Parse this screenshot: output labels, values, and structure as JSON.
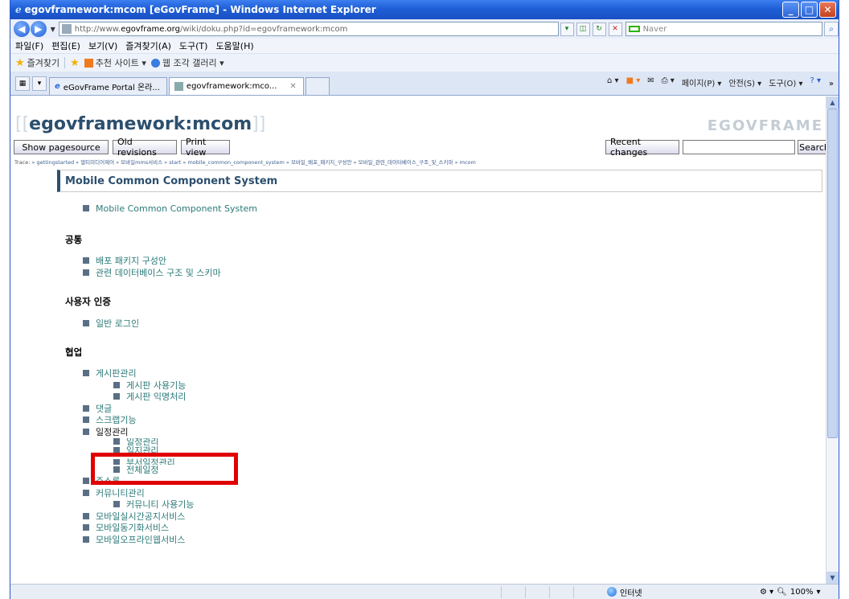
{
  "window": {
    "title": "egovframework:mcom [eGovFrame] - Windows Internet Explorer"
  },
  "address": {
    "url_prefix": "http://www.",
    "url_domain": "egovframe.org",
    "url_rest": "/wiki/doku.php?id=egovframework:mcom",
    "search_placeholder": "Naver"
  },
  "menu": [
    "파일(F)",
    "편집(E)",
    "보기(V)",
    "즐겨찾기(A)",
    "도구(T)",
    "도움말(H)"
  ],
  "favorites": {
    "label": "즐겨찾기",
    "items": [
      "추천 사이트 ▾",
      "웹 조각 갤러리 ▾"
    ]
  },
  "tabs": [
    {
      "label": "eGovFrame Portal 온라..."
    },
    {
      "label": "egovframework:mco..."
    }
  ],
  "command_bar": [
    "페이지(P) ▾",
    "안전(S) ▾",
    "도구(O) ▾"
  ],
  "page": {
    "title": "egovframework:mcom",
    "brand": "EGOVFRAME",
    "buttons": {
      "show_source": "Show pagesource",
      "old_revisions": "Old revisions",
      "print_view": "Print view",
      "recent_changes": "Recent changes",
      "search": "Search"
    },
    "trace_label": "Trace:",
    "trace": "» gettingstarted » 멀티미디어제어 » 모바일mms서비스 » start » mobile_common_component_system » 모바일_배포_패키지_구성안 » 모바일_관련_데이터베이스_구조_및_스키마 » mcom",
    "section_title": "Mobile Common Component System",
    "intro_link": "Mobile Common Component System",
    "sections": [
      {
        "heading": "공통",
        "items": [
          "배포 패키지 구성안",
          "관련 데이터베이스 구조 및 스키마"
        ]
      },
      {
        "heading": "사용자 인증",
        "items": [
          "일반 로그인"
        ]
      },
      {
        "heading": "협업"
      }
    ],
    "collab": {
      "board": "게시판관리",
      "board_sub": [
        "게시판 사용기능",
        "게시판 익명처리"
      ],
      "comment": "댓글",
      "scrap": "스크랩기능",
      "schedule": "일정관리",
      "schedule_sub": [
        "일정관리",
        "일지관리",
        "부서일정관리",
        "전체일정"
      ],
      "address": "주소록",
      "community": "커뮤니티관리",
      "community_sub": [
        "커뮤니티 사용기능"
      ],
      "tail": [
        "모바일실시간공지서비스",
        "모바일동기화서비스",
        "모바일오프라인웹서비스"
      ]
    }
  },
  "status": {
    "zone": "인터넷",
    "zoom": "100%"
  }
}
